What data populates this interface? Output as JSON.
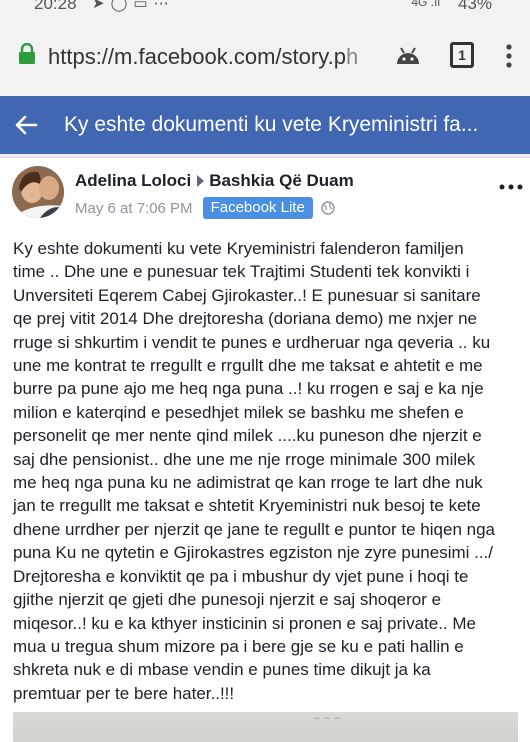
{
  "status_bar": {
    "time": "20:28",
    "battery": "43%",
    "icons": [
      "navigation-icon",
      "whatsapp-icon",
      "message-icon",
      "more-dots-icon",
      "4g-icon",
      "signal-icon"
    ]
  },
  "browser": {
    "url_main": "https://m.facebook.com/story.p",
    "url_faded": "h",
    "tab_count": "1"
  },
  "header": {
    "title": "Ky eshte dokumenti ku vete Kryeministri fa..."
  },
  "post": {
    "author": "Adelina Loloci",
    "group": "Bashkia Që Duam",
    "timestamp": "May 6 at 7:06 PM",
    "badge": "Facebook Lite",
    "text": "Ky eshte dokumenti ku vete Kryeministri falenderon familjen\ntime .. Dhe une e punesuar tek Trajtimi Studenti tek konvikti i\nUnversiteti Eqerem Cabej Gjirokaster..! E punesuar si sanitare\nqe prej vitit 2014 Dhe drejtoresha (doriana demo) me nxjer ne\nrruge si shkurtim i vendit te punes e urdheruar nga qeveria .. ku\nune me kontrat te rregullt e rrgullt dhe me taksat e ahtetit e me\nburre pa pune ajo me heq nga puna ..! ku rrogen e saj e ka nje\nmilion e katerqind e pesedhjet milek se bashku me shefen e\npersonelit qe mer nente qind milek ....ku puneson dhe njerzit e\nsaj dhe pensionist.. dhe une me nje rroge minimale 300 milek\nme heq nga puna ku ne adimistrat qe kan rroge te lart dhe nuk\njan te rregullt me taksat e shtetit Kryeministri nuk besoj te kete\ndhene urrdher per njerzit qe jane te regullt e puntor te hiqen nga\npuna Ku ne qytetin e Gjirokastres egziston nje zyre punesimi .../\nDrejtoresha e konviktit qe pa i mbushur dy vjet pune i hoqi te\ngjithe njerzit qe gjeti dhe punesoji njerzit e saj shoqeror e\nmiqesor..! ku e ka kthyer insticinin si pronen e saj private.. Me\nmua u tregua shum mizore pa i bere gje se ku e pati hallin e\nshkreta nuk e di mbase vendin e punes time dikujt ja ka\npremtuar per te bere hater..!!!"
  },
  "colors": {
    "header_blue": "#4267b2",
    "badge_blue": "#4a90e2",
    "lock_green": "#2e9b3c"
  }
}
